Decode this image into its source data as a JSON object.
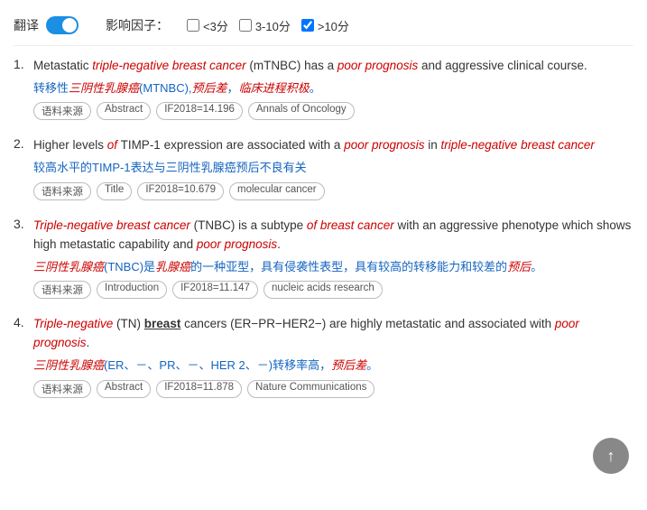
{
  "toolbar": {
    "translate_label": "翻译",
    "influence_label": "影响因子：",
    "filters": [
      {
        "id": "f1",
        "label": "<3分",
        "checked": false
      },
      {
        "id": "f2",
        "label": "3-10分",
        "checked": false
      },
      {
        "id": "f3",
        "label": ">10分",
        "checked": true
      }
    ]
  },
  "results": [
    {
      "number": "1.",
      "en_html": "Metastatic <span class='italic-red'>triple-negative breast cancer</span> (mTNBC) has a <span class='italic-red'>poor prognosis</span> and aggressive clinical course.",
      "zh_html": "转移性<span class='italic-red'>三阴性乳腺癌</span>(MTNBC),<span class='italic-red'>预后差</span>，<span class='italic-red'>临床进程积极</span>。",
      "badges": [
        "语料来源",
        "Abstract",
        "IF2018=14.196",
        "Annals of Oncology"
      ]
    },
    {
      "number": "2.",
      "en_html": "Higher levels <span class='italic-red'>of</span> TIMP-1 expression are associated with a <span class='italic-red'>poor prognosis</span> in <span class='italic-red'>triple-negative breast cancer</span>",
      "zh_html": "较高水平的TIMP-1表达与三阴性乳腺癌预后不良有关",
      "badges": [
        "语料来源",
        "Title",
        "IF2018=10.679",
        "molecular cancer"
      ]
    },
    {
      "number": "3.",
      "en_html": "<span class='italic-red'>Triple-negative breast cancer</span> (TNBC) is a subtype <span class='italic-red'>of breast cancer</span> with an aggressive phenotype which shows high metastatic capability and <span class='italic-red'>poor prognosis</span>.",
      "zh_html": "<span class='italic-red'>三阴性乳腺癌</span>(TNBC)是<span class='italic-red'>乳腺癌</span>的一种亚型，具有侵袭性表型，具有较高的转移能力和较差的<span class='italic-red'>预后</span>。",
      "badges": [
        "语料来源",
        "Introduction",
        "IF2018=11.147",
        "nucleic acids research"
      ]
    },
    {
      "number": "4.",
      "en_html": "<span class='italic-red'>Triple-negative</span> (TN) <span class='bold-underline'>breast</span> cancers (ER−PR−HER2−) are highly metastatic and associated with <span class='italic-red'>poor prognosis</span>.",
      "zh_html": "<span class='italic-red'>三阴性乳腺癌</span>(ER、－、PR、－、HER 2、－)转移率高，<span class='italic-red'>预后差</span>。",
      "badges": [
        "语料来源",
        "Abstract",
        "IF2018=11.878",
        "Nature Communications"
      ]
    }
  ],
  "scroll_top_title": "返回顶部"
}
